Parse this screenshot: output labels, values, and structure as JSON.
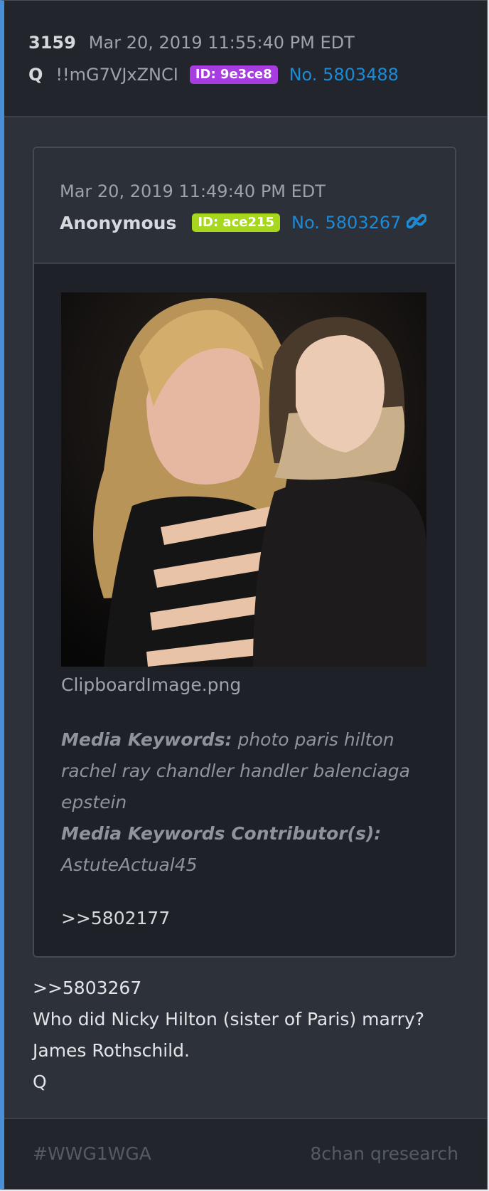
{
  "post": {
    "count": "3159",
    "date": "Mar 20, 2019 11:55:40 PM EDT",
    "author": "Q",
    "tripcode": "!!mG7VJxZNCI",
    "id_badge": "ID: 9e3ce8",
    "id_color": "#a73ce0",
    "post_no": "No. 5803488"
  },
  "quoted": {
    "date": "Mar 20, 2019 11:49:40 PM EDT",
    "author": "Anonymous",
    "id_badge": "ID: ace215",
    "id_color": "#a8d81e",
    "post_no": "No. 5803267",
    "link_icon": "link-icon",
    "filename": "ClipboardImage.png",
    "keywords_label": "Media Keywords:",
    "keywords": "photo paris hilton rachel ray chandler handler balenciaga epstein",
    "contributors_label": "Media Keywords Contributor(s):",
    "contributors": "AstuteActual45",
    "reference": ">>5802177"
  },
  "message": {
    "line1": ">>5803267",
    "line2": "Who did Nicky Hilton (sister of Paris) marry?",
    "line3": "James Rothschild.",
    "line4": "Q"
  },
  "footer": {
    "hashtag": "#WWG1WGA",
    "source": "8chan qresearch"
  }
}
